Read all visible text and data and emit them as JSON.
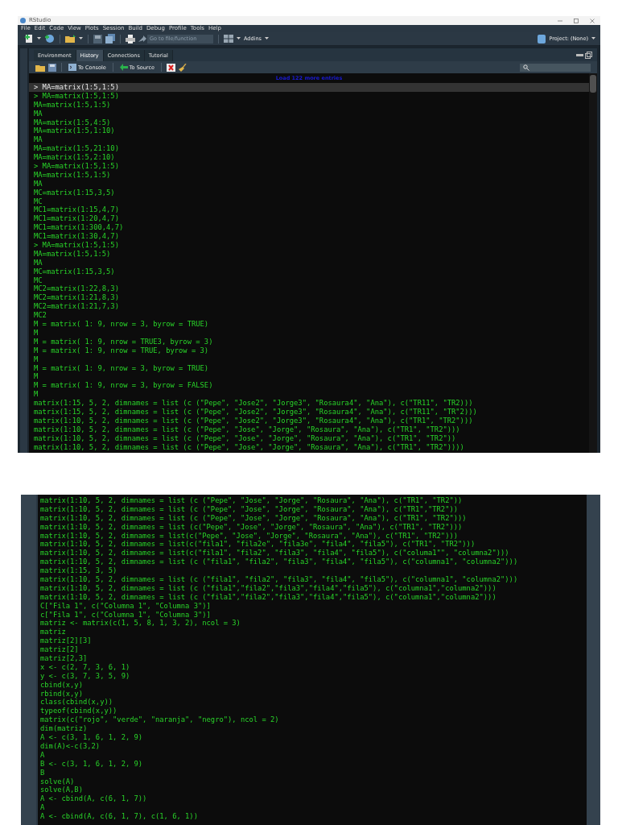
{
  "window": {
    "title": "RStudio"
  },
  "menu": [
    "File",
    "Edit",
    "Code",
    "View",
    "Plots",
    "Session",
    "Build",
    "Debug",
    "Profile",
    "Tools",
    "Help"
  ],
  "toolbar": {
    "goto_placeholder": "Go to file/function",
    "addins": "Addins",
    "project": "Project: (None)"
  },
  "pane": {
    "tabs": [
      {
        "label": "Environment",
        "selected": false
      },
      {
        "label": "History",
        "selected": true
      },
      {
        "label": "Connections",
        "selected": false
      },
      {
        "label": "Tutorial",
        "selected": false
      }
    ],
    "actions": {
      "to_console": "To Console",
      "to_source": "To Source"
    },
    "load_more": "Load 122 more entries",
    "history": [
      {
        "text": "> MA=matrix(1:5,1:5)",
        "selected": true
      },
      {
        "text": "> MA=matrix(1:5,1:5)",
        "selected": false
      },
      {
        "text": "MA=matrix(1:5,1:5)",
        "selected": false
      },
      {
        "text": "MA",
        "selected": false
      },
      {
        "text": "MA=matrix(1:5,4:5)",
        "selected": false
      },
      {
        "text": "MA=matrix(1:5,1:10)",
        "selected": false
      },
      {
        "text": "MA",
        "selected": false
      },
      {
        "text": "MA=matrix(1:5,21:10)",
        "selected": false
      },
      {
        "text": "MA=matrix(1:5,2:10)",
        "selected": false
      },
      {
        "text": "> MA=matrix(1:5,1:5)",
        "selected": false
      },
      {
        "text": "MA=matrix(1:5,1:5)",
        "selected": false
      },
      {
        "text": "MA",
        "selected": false
      },
      {
        "text": "MC=matrix(1:15,3,5)",
        "selected": false
      },
      {
        "text": "MC",
        "selected": false
      },
      {
        "text": "MC1=matrix(1:15,4,7)",
        "selected": false
      },
      {
        "text": "MC1=matrix(1:20,4,7)",
        "selected": false
      },
      {
        "text": "MC1=matrix(1:300,4,7)",
        "selected": false
      },
      {
        "text": "MC1=matrix(1:30,4,7)",
        "selected": false
      },
      {
        "text": "> MA=matrix(1:5,1:5)",
        "selected": false
      },
      {
        "text": "MA=matrix(1:5,1:5)",
        "selected": false
      },
      {
        "text": "MA",
        "selected": false
      },
      {
        "text": "MC=matrix(1:15,3,5)",
        "selected": false
      },
      {
        "text": "MC",
        "selected": false
      },
      {
        "text": "MC2=matrix(1:22,8,3)",
        "selected": false
      },
      {
        "text": "MC2=matrix(1:21,8,3)",
        "selected": false
      },
      {
        "text": "MC2=matrix(1:21,7,3)",
        "selected": false
      },
      {
        "text": "MC2",
        "selected": false
      },
      {
        "text": "M = matrix( 1: 9, nrow = 3, byrow = TRUE)",
        "selected": false
      },
      {
        "text": "M",
        "selected": false
      },
      {
        "text": "M = matrix( 1: 9, nrow = TRUE3, byrow = 3)",
        "selected": false
      },
      {
        "text": "M = matrix( 1: 9, nrow = TRUE, byrow = 3)",
        "selected": false
      },
      {
        "text": "M",
        "selected": false
      },
      {
        "text": "M = matrix( 1: 9, nrow = 3, byrow = TRUE)",
        "selected": false
      },
      {
        "text": "M",
        "selected": false
      },
      {
        "text": "M = matrix( 1: 9, nrow = 3, byrow = FALSE)",
        "selected": false
      },
      {
        "text": "M",
        "selected": false
      },
      {
        "text": "matrix(1:15, 5, 2, dimnames = list (c (\"Pepe\", \"Jose2\", \"Jorge3\", \"Rosaura4\", \"Ana\"), c(\"TR11\", \"TR2)))",
        "selected": false
      },
      {
        "text": "matrix(1:15, 5, 2, dimnames = list (c (\"Pepe\", \"Jose2\", \"Jorge3\", \"Rosaura4\", \"Ana\"), c(\"TR11\", \"TR\"2)))",
        "selected": false
      },
      {
        "text": "matrix(1:10, 5, 2, dimnames = list (c (\"Pepe\", \"Jose2\", \"Jorge3\", \"Rosaura4\", \"Ana\"), c(\"TR1\", \"TR2\")))",
        "selected": false
      },
      {
        "text": "matrix(1:10, 5, 2, dimnames = list (c (\"Pepe\", \"Jose\", \"Jorge\", \"Rosaura\", \"Ana\"), c(\"TR1\", \"TR2\")))",
        "selected": false
      },
      {
        "text": "matrix(1:10, 5, 2, dimnames = list (c (\"Pepe\", \"Jose\", \"Jorge\", \"Rosaura\", \"Ana\"), c(\"TR1\", \"TR2\"))",
        "selected": false
      },
      {
        "text": "matrix(1:10, 5, 2, dimnames = list (c (\"Pepe\", \"Jose\", \"Jorge\", \"Rosaura\", \"Ana\"), c(\"TR1\", \"TR2\"))))",
        "selected": false
      }
    ]
  },
  "lower_pane": {
    "history": [
      {
        "text": "matrix(1:10, 5, 2, dimnames = list (c (\"Pepe\", \"Jose\", \"Jorge\", \"Rosaura\", \"Ana\"), c(\"TR1\", \"TR2\"))",
        "selected": false
      },
      {
        "text": "matrix(1:10, 5, 2, dimnames = list (c (\"Pepe\", \"Jose\", \"Jorge\", \"Rosaura\", \"Ana\"), c(\"TR1\",\"TR2\"))",
        "selected": false
      },
      {
        "text": "matrix(1:10, 5, 2, dimnames = list (c (\"Pepe\", \"Jose\", \"Jorge\", \"Rosaura\", \"Ana\"), c(\"TR1\", \"TR2\")))",
        "selected": false
      },
      {
        "text": "matrix(1:10, 5, 2, dimnames = list (c(\"Pepe\", \"Jose\", \"Jorge\", \"Rosaura\", \"Ana\"), c(\"TR1\", \"TR2\")))",
        "selected": false
      },
      {
        "text": "matrix(1:10, 5, 2, dimnames = list(c(\"Pepe\", \"Jose\", \"Jorge\", \"Rosaura\", \"Ana\"), c(\"TR1\", \"TR2\")))",
        "selected": false
      },
      {
        "text": "matrix(1:10, 5, 2, dimnames = list(c(\"fila1\", \"fila2e\", \"fila3e\", \"fila4\", \"fila5\"), c(\"TR1\", \"TR2\")))",
        "selected": false
      },
      {
        "text": "matrix(1:10, 5, 2, dimnames = list(c(\"fila1\", \"fila2\", \"fila3\", \"fila4\", \"fila5\"), c(\"columa1\"\", \"columna2\")))",
        "selected": false
      },
      {
        "text": "matrix(1:10, 5, 2, dimnames = list (c (\"fila1\", \"fila2\", \"fila3\", \"fila4\", \"fila5\"), c(\"columna1\", \"columna2\")))",
        "selected": false
      },
      {
        "text": "matrix(1:15, 3, 5)",
        "selected": false
      },
      {
        "text": "matrix(1:10, 5, 2, dimnames = list (c (\"fila1\", \"fila2\", \"fila3\", \"fila4\", \"fila5\"), c(\"columna1\", \"columna2\")))",
        "selected": false
      },
      {
        "text": "matrix(1:10, 5, 2, dimnames = list (c (\"fila1\",\"fila2\",\"fila3\",\"fila4\",\"fila5\"), c(\"columna1\",\"columna2\")))",
        "selected": false
      },
      {
        "text": "matrix(1:10, 5, 2, dimnames = list (c (\"fila1\",\"fila2\",\"fila3\",\"fila4\",\"fila5\"), c(\"columna1\",\"columna2\")))",
        "selected": false
      },
      {
        "text": "C[\"Fila 1\", c(\"Columna 1\", \"Columna 3\")]",
        "selected": false
      },
      {
        "text": "c[\"Fila 1\", c(\"Columna 1\", \"Columna 3\")]",
        "selected": false
      },
      {
        "text": "matriz <- matrix(c(1, 5, 8, 1, 3, 2), ncol = 3)",
        "selected": false
      },
      {
        "text": "matriz",
        "selected": false
      },
      {
        "text": "matriz[2][3]",
        "selected": false
      },
      {
        "text": "matriz[2]",
        "selected": false
      },
      {
        "text": "matriz[2,3]",
        "selected": false
      },
      {
        "text": "x <- c(2, 7, 3, 6, 1)",
        "selected": false
      },
      {
        "text": "y <- c(3, 7, 3, 5, 9)",
        "selected": false
      },
      {
        "text": "cbind(x,y)",
        "selected": false
      },
      {
        "text": "rbind(x,y)",
        "selected": false
      },
      {
        "text": "class(cbind(x,y))",
        "selected": false
      },
      {
        "text": "typeof(cbind(x,y))",
        "selected": false
      },
      {
        "text": "matrix(c(\"rojo\", \"verde\", \"naranja\", \"negro\"), ncol = 2)",
        "selected": false
      },
      {
        "text": "dim(matriz)",
        "selected": false
      },
      {
        "text": "A <- c(3, 1, 6, 1, 2, 9)",
        "selected": false
      },
      {
        "text": "dim(A)<-c(3,2)",
        "selected": false
      },
      {
        "text": "A",
        "selected": false
      },
      {
        "text": "B <- c(3, 1, 6, 1, 2, 9)",
        "selected": false
      },
      {
        "text": "B",
        "selected": false
      },
      {
        "text": "solve(A)",
        "selected": false
      },
      {
        "text": "solve(A,B)",
        "selected": false
      },
      {
        "text": "A <- cbind(A, c(6, 1, 7))",
        "selected": false
      },
      {
        "text": "A",
        "selected": false
      },
      {
        "text": "A <- cbind(A, c(6, 1, 7), c(1, 6, 1))",
        "selected": false
      }
    ]
  }
}
